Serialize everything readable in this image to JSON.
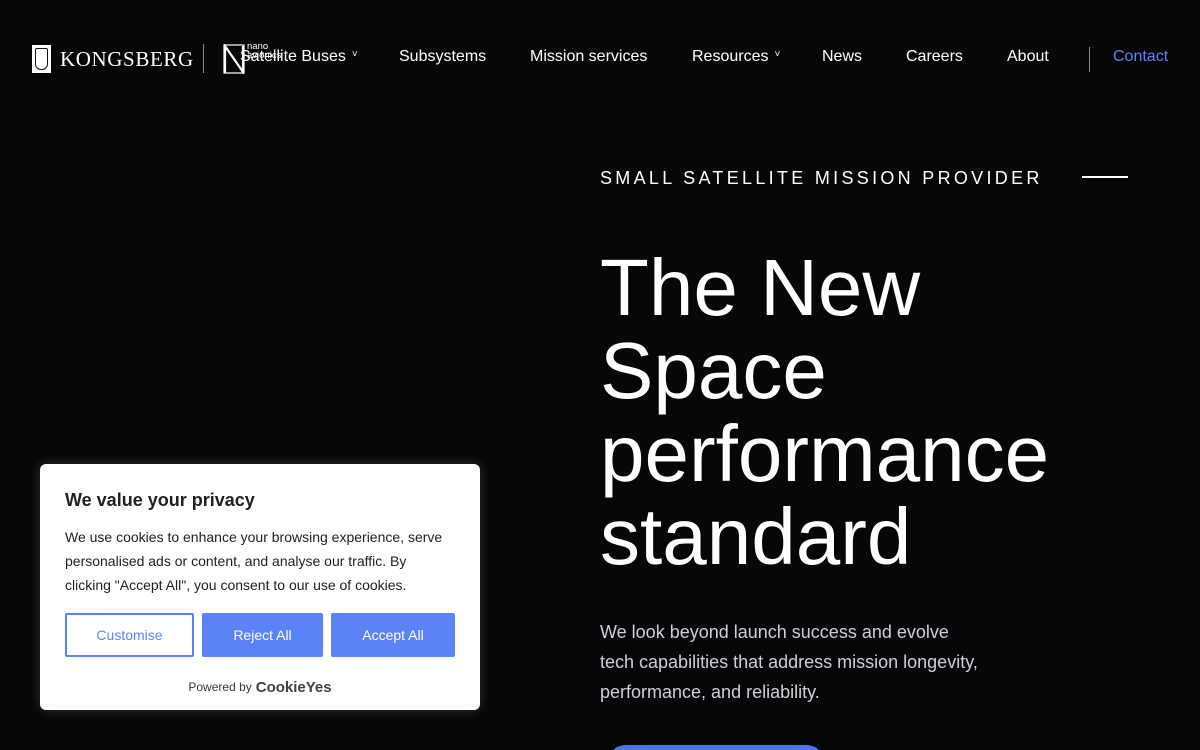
{
  "brand": {
    "company": "KONGSBERG",
    "sub_brand_line1": "nano",
    "sub_brand_line2": "avionics"
  },
  "nav": {
    "items": [
      {
        "label": "Satellite Buses",
        "has_dropdown": true
      },
      {
        "label": "Subsystems",
        "has_dropdown": false
      },
      {
        "label": "Mission services",
        "has_dropdown": false
      },
      {
        "label": "Resources",
        "has_dropdown": true
      },
      {
        "label": "News",
        "has_dropdown": false
      },
      {
        "label": "Careers",
        "has_dropdown": false
      },
      {
        "label": "About",
        "has_dropdown": false
      }
    ],
    "contact": "Contact",
    "dropdown_glyph": "˅"
  },
  "hero": {
    "eyebrow": "SMALL SATELLITE MISSION PROVIDER",
    "title_lines": [
      "The New",
      "Space",
      "performance",
      "standard"
    ],
    "description_lines": [
      "We look beyond launch success and evolve",
      "tech capabilities that address mission longevity,",
      "performance, and reliability."
    ]
  },
  "cookie_banner": {
    "title": "We value your privacy",
    "text_lines": [
      "We use cookies to enhance your browsing experience, serve",
      "personalised ads or content, and analyse our traffic. By",
      "clicking \"Accept All\", you consent to our use of cookies."
    ],
    "customise": "Customise",
    "reject_all": "Reject All",
    "accept_all": "Accept All",
    "powered_by": "Powered by",
    "powered_brand": "CookieYes"
  },
  "colors": {
    "background": "#070709",
    "accent": "#5b83f5",
    "text": "#ffffff"
  }
}
